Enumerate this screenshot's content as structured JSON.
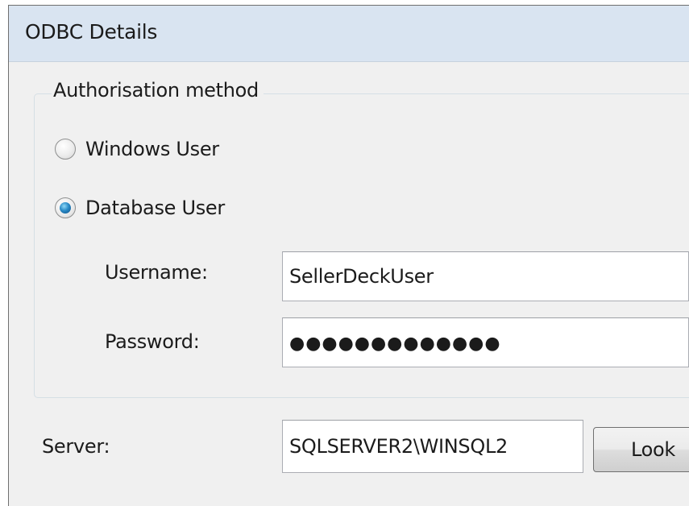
{
  "window": {
    "title": "ODBC Details"
  },
  "auth_group": {
    "legend": "Authorisation method",
    "options": [
      {
        "label": "Windows User",
        "selected": false
      },
      {
        "label": "Database User",
        "selected": true
      }
    ],
    "username": {
      "label": "Username:",
      "value": "SellerDeckUser"
    },
    "password": {
      "label": "Password:",
      "value": "●●●●●●●●●●●●●"
    }
  },
  "server": {
    "label": "Server:",
    "value": "SQLSERVER2\\WINSQL2",
    "lookup_button": "Look"
  },
  "colors": {
    "title_bar": "#d9e4f1",
    "dialog_bg": "#f0f0f0",
    "radio_selected": "#2a8bc7"
  }
}
